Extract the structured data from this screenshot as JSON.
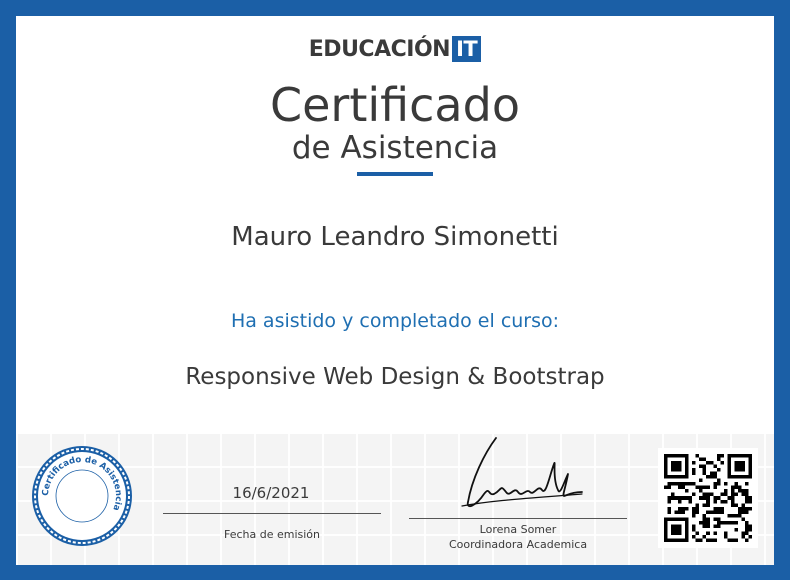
{
  "logo": {
    "text": "EDUCACIÓN",
    "badge": "IT"
  },
  "title": "Certificado",
  "subtitle": "de Asistencia",
  "recipient_name": "Mauro Leandro Simonetti",
  "attended_text": "Ha asistido y completado el curso:",
  "course_name": "Responsive Web Design & Bootstrap",
  "issue": {
    "date": "16/6/2021",
    "label": "Fecha de emisión"
  },
  "signatory": {
    "name": "Lorena Somer",
    "role": "Coordinadora Academica"
  },
  "seal": {
    "text": "Certificado de Asistencia"
  },
  "colors": {
    "brand_blue": "#1b5fa6",
    "accent_text": "#1f6fb2",
    "text_dark": "#3a3a3a"
  }
}
